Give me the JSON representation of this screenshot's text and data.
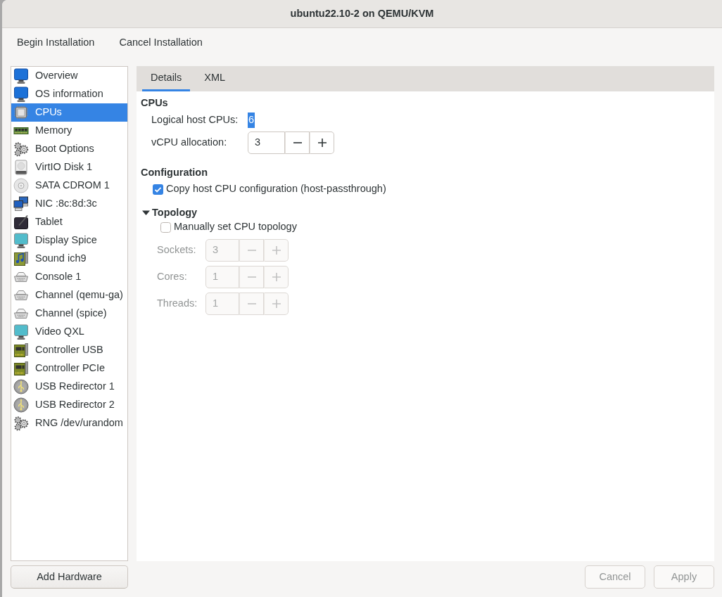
{
  "window": {
    "title": "ubuntu22.10-2 on QEMU/KVM"
  },
  "menu": [
    "Begin Installation",
    "Cancel Installation"
  ],
  "sidebar": {
    "items": [
      {
        "label": "Overview",
        "kind": "overview",
        "selected": false
      },
      {
        "label": "OS information",
        "kind": "os",
        "selected": false
      },
      {
        "label": "CPUs",
        "kind": "cpu",
        "selected": true
      },
      {
        "label": "Memory",
        "kind": "memory",
        "selected": false
      },
      {
        "label": "Boot Options",
        "kind": "boot",
        "selected": false
      },
      {
        "label": "VirtIO Disk 1",
        "kind": "disk",
        "selected": false
      },
      {
        "label": "SATA CDROM 1",
        "kind": "cdrom",
        "selected": false
      },
      {
        "label": "NIC :8c:8d:3c",
        "kind": "nic",
        "selected": false
      },
      {
        "label": "Tablet",
        "kind": "tablet",
        "selected": false
      },
      {
        "label": "Display Spice",
        "kind": "display",
        "selected": false
      },
      {
        "label": "Sound ich9",
        "kind": "sound",
        "selected": false
      },
      {
        "label": "Console 1",
        "kind": "console",
        "selected": false
      },
      {
        "label": "Channel (qemu-ga)",
        "kind": "channel",
        "selected": false
      },
      {
        "label": "Channel (spice)",
        "kind": "channel",
        "selected": false
      },
      {
        "label": "Video QXL",
        "kind": "video",
        "selected": false
      },
      {
        "label": "Controller USB",
        "kind": "controller",
        "selected": false
      },
      {
        "label": "Controller PCIe",
        "kind": "controller",
        "selected": false
      },
      {
        "label": "USB Redirector 1",
        "kind": "redirdev",
        "selected": false
      },
      {
        "label": "USB Redirector 2",
        "kind": "redirdev",
        "selected": false
      },
      {
        "label": "RNG /dev/urandom",
        "kind": "rng",
        "selected": false
      }
    ]
  },
  "tabs": [
    {
      "label": "Details",
      "selected": true
    },
    {
      "label": "XML",
      "selected": false
    }
  ],
  "cpus": {
    "heading": "CPUs",
    "logical_host_cpus": {
      "label": "Logical host CPUs:",
      "value": "6",
      "highlighted": true
    },
    "vcpu_allocation": {
      "label": "vCPU allocation:",
      "value": "3",
      "disabled": false
    }
  },
  "configuration": {
    "heading": "Configuration",
    "copy_host": {
      "label": "Copy host CPU configuration (host-passthrough)",
      "checked": true
    }
  },
  "topology": {
    "heading": "Topology",
    "expanded": true,
    "manual": {
      "label": "Manually set CPU topology",
      "checked": false
    },
    "fields": [
      {
        "label": "Sockets:",
        "value": "3",
        "disabled": true
      },
      {
        "label": "Cores:",
        "value": "1",
        "disabled": true
      },
      {
        "label": "Threads:",
        "value": "1",
        "disabled": true
      }
    ]
  },
  "buttons": {
    "add_hardware": {
      "label": "Add Hardware",
      "disabled": false
    },
    "cancel": {
      "label": "Cancel",
      "disabled": true
    },
    "apply": {
      "label": "Apply",
      "disabled": true
    }
  }
}
